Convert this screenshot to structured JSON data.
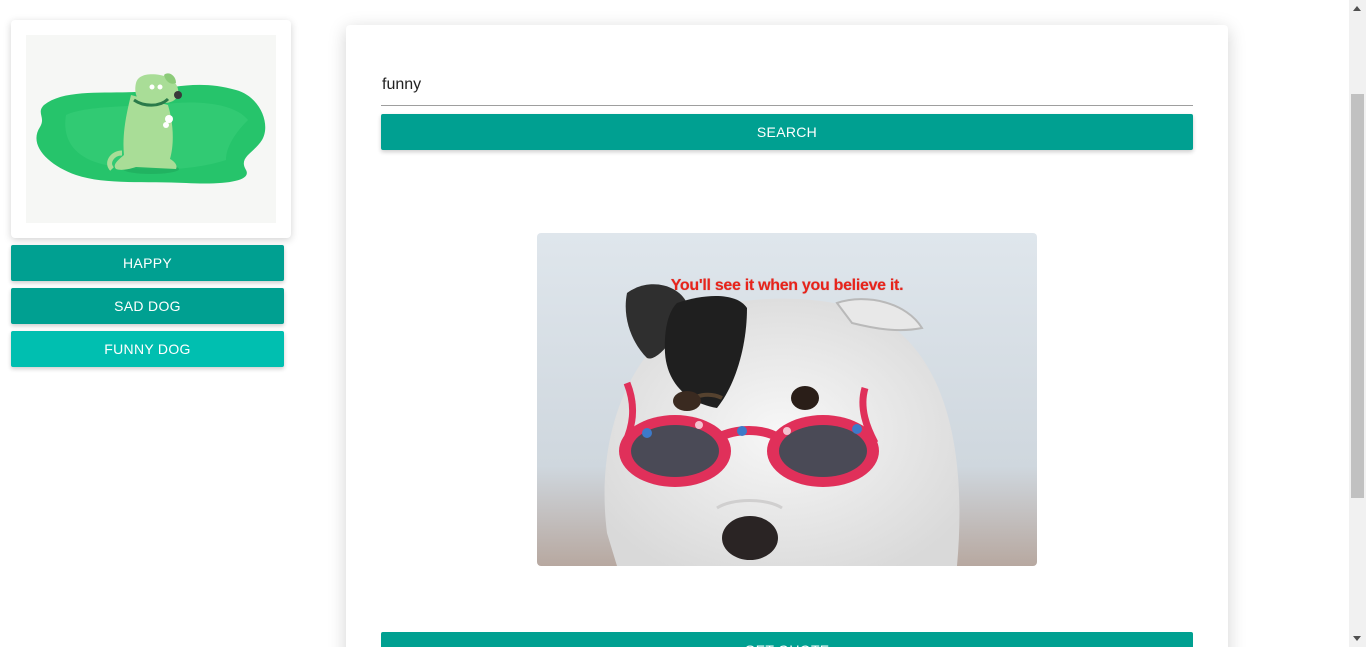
{
  "sidebar": {
    "logo": {
      "icon": "dog-on-grass-illustration"
    },
    "buttons": [
      {
        "label": "HAPPY"
      },
      {
        "label": "SAD DOG"
      },
      {
        "label": "FUNNY DOG"
      }
    ]
  },
  "main": {
    "search": {
      "value": "funny"
    },
    "search_button": "SEARCH",
    "image": {
      "caption": "You'll see it when you believe it."
    },
    "quote_button": "GET QUOTE"
  },
  "colors": {
    "accent": "#00a091",
    "accent_active": "#00bfb0",
    "caption": "#e8231a"
  }
}
